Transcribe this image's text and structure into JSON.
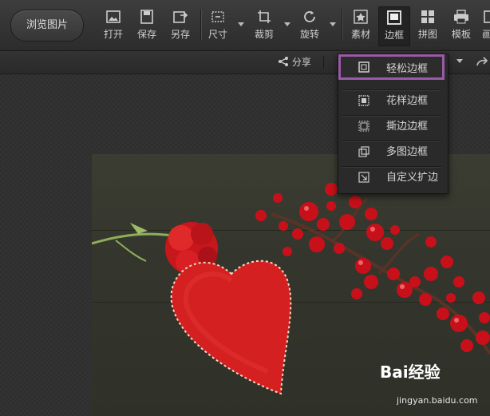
{
  "browse_button": "浏览图片",
  "toolbar": {
    "tools": [
      {
        "id": "open",
        "label": "打开",
        "icon": "open-image-icon"
      },
      {
        "id": "save",
        "label": "保存",
        "icon": "save-icon"
      },
      {
        "id": "saveas",
        "label": "另存",
        "icon": "save-as-icon"
      },
      {
        "id": "size",
        "label": "尺寸",
        "icon": "resize-icon"
      },
      {
        "id": "crop",
        "label": "裁剪",
        "icon": "crop-icon"
      },
      {
        "id": "rotate",
        "label": "旋转",
        "icon": "rotate-icon"
      },
      {
        "id": "material",
        "label": "素材",
        "icon": "star-material-icon"
      },
      {
        "id": "border",
        "label": "边框",
        "icon": "border-frame-icon"
      },
      {
        "id": "collage",
        "label": "拼图",
        "icon": "collage-grid-icon"
      },
      {
        "id": "template",
        "label": "模板",
        "icon": "template-print-icon"
      },
      {
        "id": "batch",
        "label": "画",
        "icon": "partial-icon"
      }
    ]
  },
  "subbar": {
    "share_label": "分享"
  },
  "border_menu": {
    "items": [
      {
        "label": "轻松边框",
        "icon": "simple-frame-icon",
        "selected": true
      },
      {
        "label": "花样边框",
        "icon": "pattern-frame-icon"
      },
      {
        "label": "撕边边框",
        "icon": "torn-edge-frame-icon"
      },
      {
        "label": "多图边框",
        "icon": "multi-image-frame-icon"
      },
      {
        "label": "自定义扩边",
        "icon": "custom-expand-icon"
      }
    ]
  },
  "watermark": {
    "brand": "Bai经验",
    "url": "jingyan.baidu.com"
  },
  "colors": {
    "selected_border": "#9a5aa8",
    "toolbar_bg": "#333333",
    "heart": "#d21f1f"
  }
}
